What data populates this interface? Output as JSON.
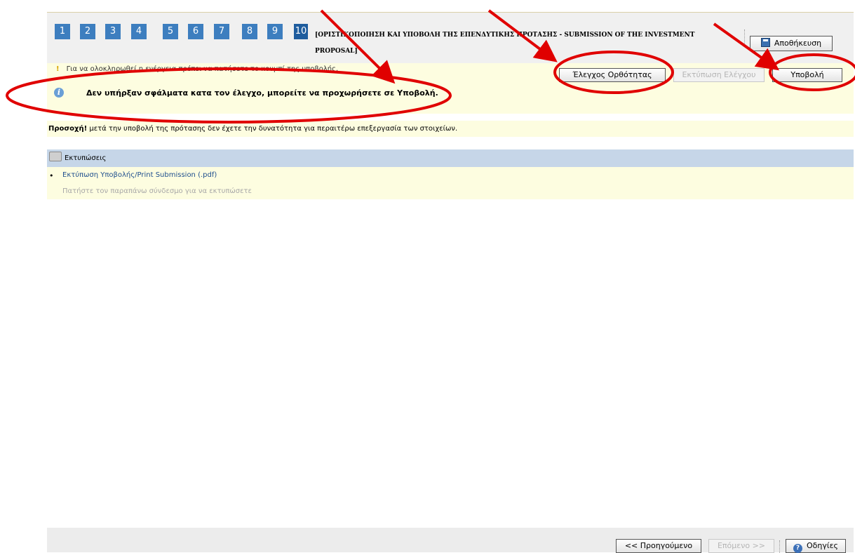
{
  "steps": [
    "1",
    "2",
    "3",
    "4",
    "5",
    "6",
    "7",
    "8",
    "9",
    "10"
  ],
  "phase_title": "[ΟΡΙΣΤΙΚΟΠΟΙΗΣΗ ΚΑΙ ΥΠΟΒΟΛΗ ΤΗΣ ΕΠΕΝΔΥΤΙΚΗΣ ΠΡΟΤΑΣΗΣ - SUBMISSION OF THE INVESTMENT PROPOSAL]",
  "toolbar": {
    "save_label": "Αποθήκευση",
    "save_icon": "floppy-disk-icon"
  },
  "messages": {
    "warning": "Για να ολοκληρωθεί η ενέργεια πρέπει να πατήσετε το κουμπί της υποβολής.",
    "info": "Δεν υπήρξαν σφάλματα κατα τον έλεγχο, μπορείτε να προχωρήσετε σε Υποβολή.",
    "caution_bold": "Προσοχή!",
    "caution_text": " μετά την υποβολή της πρότασης δεν έχετε την δυνατότητα για περαιτέρω επεξεργασία των στοιχείων."
  },
  "actions": {
    "check_label": "Έλεγχος Ορθότητας",
    "print_check_label": "Εκτύπωση Ελέγχου",
    "submit_label": "Υποβολή"
  },
  "prints": {
    "header": "Εκτυπώσεις",
    "link": "Εκτύπωση Υποβολής/Print Submission (.pdf)",
    "hint": "Πατήστε τον παραπάνω σύνδεσμο για να εκτυπώσετε"
  },
  "footer": {
    "prev_label": "<< Προηγούμενο",
    "next_label": "Επόμενο >>",
    "help_label": "Οδηγίες"
  },
  "colors": {
    "step_blue": "#3d7ebf",
    "highlight_bg": "#fdfde0",
    "section_header": "#c6d6e8",
    "annotation_red": "#e00000"
  }
}
